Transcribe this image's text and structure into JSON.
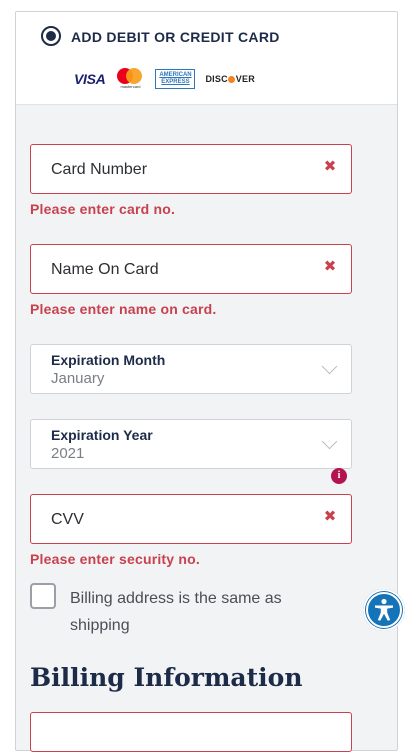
{
  "payment_option": {
    "label": "ADD DEBIT OR CREDIT CARD",
    "logos": {
      "visa": "VISA",
      "mastercard": "mastercard",
      "amex_line1": "AMERICAN",
      "amex_line2": "EXPRESS",
      "discover_pre": "DISC",
      "discover_post": "VER"
    }
  },
  "card_form": {
    "card_number": {
      "placeholder": "Card Number",
      "error": "Please enter card no."
    },
    "name_on_card": {
      "placeholder": "Name On Card",
      "error": "Please enter name on card."
    },
    "expiration_month": {
      "label": "Expiration Month",
      "value": "January"
    },
    "expiration_year": {
      "label": "Expiration Year",
      "value": "2021"
    },
    "cvv": {
      "placeholder": "CVV",
      "error": "Please enter security no.",
      "info_glyph": "i"
    },
    "billing_same": {
      "label": "Billing address is the same as shipping",
      "checked": false
    }
  },
  "billing": {
    "title": "Billing Information"
  },
  "colors": {
    "error": "#c8414f",
    "navy": "#1d2b49",
    "info": "#b3134f",
    "a11y": "#1573b8"
  },
  "icons": {
    "error": "close-icon",
    "dropdown": "chevron-down-icon",
    "accessibility": "accessibility-icon"
  }
}
